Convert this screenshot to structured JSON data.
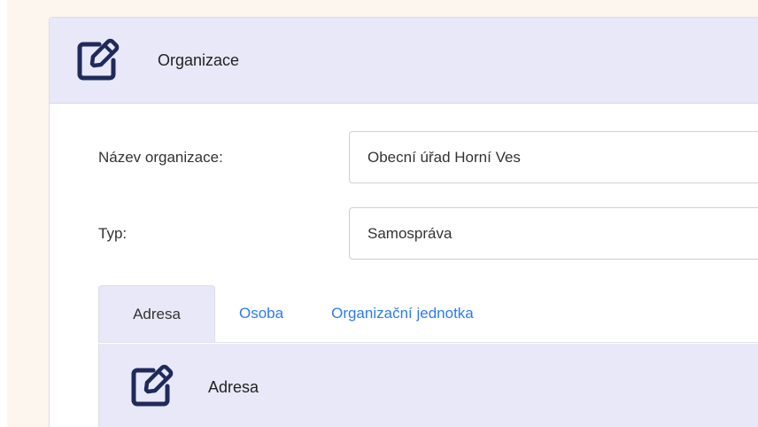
{
  "colors": {
    "background": "#fdf6ee",
    "header_bg": "#e8e8f8",
    "icon_color": "#1f2a5c",
    "link_blue": "#2d7bf0"
  },
  "card": {
    "header": {
      "icon": "edit-icon",
      "title": "Organizace"
    },
    "fields": {
      "name": {
        "label": "Název organizace:",
        "value": "Obecní úřad Horní Ves"
      },
      "type": {
        "label": "Typ:",
        "value": "Samospráva"
      }
    },
    "tabs": [
      {
        "label": "Adresa",
        "active": true
      },
      {
        "label": "Osoba",
        "active": false
      },
      {
        "label": "Organizační jednotka",
        "active": false
      }
    ],
    "sub_card": {
      "icon": "edit-icon",
      "title": "Adresa"
    }
  }
}
